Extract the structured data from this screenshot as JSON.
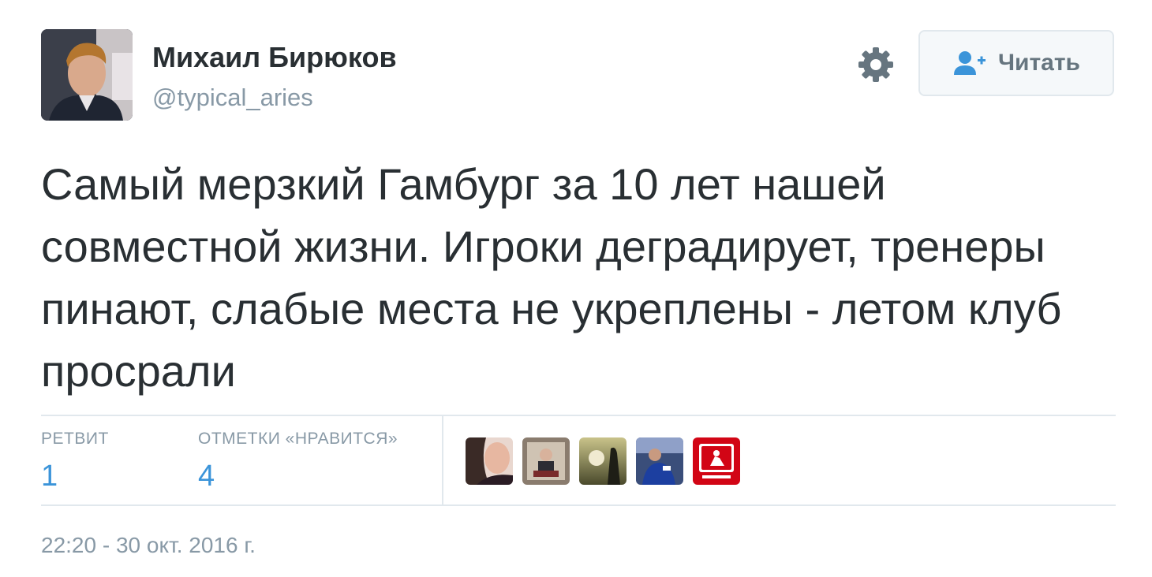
{
  "user": {
    "name": "Михаил Бирюков",
    "handle": "@typical_aries"
  },
  "follow_button": {
    "label": "Читать",
    "icon": "add-user-icon"
  },
  "menu": {
    "icon": "gear-icon"
  },
  "tweet": {
    "text": "Самый мерзкий Гамбург за 10 лет нашей совместной жизни. Игроки деградирует, тренеры пинают, слабые места не укреплены - летом клуб просрали"
  },
  "stats": {
    "retweets_label": "РЕТВИТ",
    "retweets_count": "1",
    "likes_label": "ОТМЕТКИ «НРАВИТСЯ»",
    "likes_count": "4"
  },
  "likers": [
    {
      "name": "liker-avatar-1"
    },
    {
      "name": "liker-avatar-2"
    },
    {
      "name": "liker-avatar-3"
    },
    {
      "name": "liker-avatar-4"
    },
    {
      "name": "liker-avatar-5"
    }
  ],
  "timestamp": "22:20 - 30 окт. 2016 г.",
  "colors": {
    "text": "#292f33",
    "muted": "#8899a6",
    "link": "#3b94d9",
    "border": "#e1e8ed"
  }
}
